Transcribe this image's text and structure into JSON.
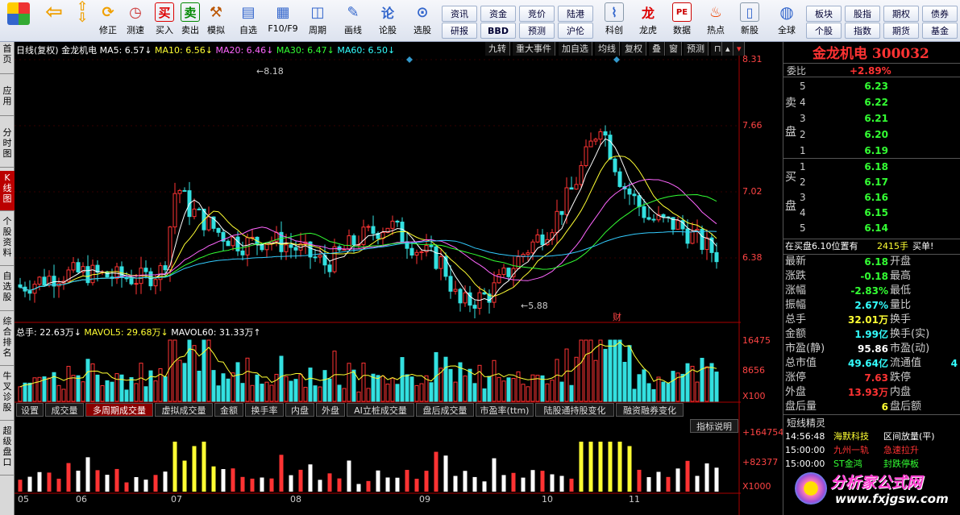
{
  "toolbar": {
    "buttons": [
      "修正",
      "测速",
      "买入",
      "卖出",
      "模拟",
      "自选",
      "F10/F9",
      "周期",
      "画线",
      "论股",
      "选股",
      "科创",
      "龙虎",
      "数据",
      "热点",
      "新股",
      "全球"
    ],
    "small_buttons": [
      "资讯",
      "研报",
      "资金",
      "BBD",
      "竞价",
      "预测",
      "陆港",
      "沪伦",
      "板块",
      "个股",
      "股指",
      "指数",
      "期权",
      "期货",
      "债券",
      "基金"
    ]
  },
  "sidebar": {
    "tabs": [
      "首页",
      "应用",
      "分时图",
      "K线图",
      "个股资料",
      "自选股",
      "综合排名",
      "牛叉诊股",
      "超级盘口"
    ]
  },
  "chart": {
    "header": {
      "period": "日线(复权)",
      "name": "金龙机电",
      "ma5": "MA5: 6.57↓",
      "ma10": "MA10: 6.56↓",
      "ma20": "MA20: 6.46↓",
      "ma30": "MA30: 6.47↓",
      "ma60": "MA60: 6.50↓"
    },
    "top_tabs": [
      "九转",
      "重大事件",
      "加自选",
      "均线",
      "复权",
      "叠",
      "窗",
      "预测"
    ],
    "price_axis": [
      "8.31",
      "7.66",
      "7.02",
      "6.38"
    ],
    "high_label": "8.18",
    "low_label": "5.88",
    "fin_marker": "财",
    "volume_header": {
      "total": "总手: 22.63万↓",
      "mavol5": "MAVOL5: 29.68万↓",
      "mavol60": "MAVOL60: 31.33万↑"
    },
    "volume_axis": [
      "16475",
      "8656",
      "X100"
    ],
    "bottom_tabs": [
      "设置",
      "成交量",
      "多周期成交量",
      "虚拟成交量",
      "金额",
      "换手率",
      "内盘",
      "外盘",
      "AI立桩成交量",
      "盘后成交量",
      "市盈率(ttm)",
      "陆股通持股变化",
      "融资融券变化"
    ],
    "indicator_note": "指标说明",
    "indicator_axis": [
      "+164754",
      "+82377",
      "X1000"
    ],
    "months": [
      "05",
      "06",
      "07",
      "08",
      "09",
      "10",
      "11"
    ]
  },
  "quote": {
    "title": "金龙机电 300032",
    "weibi_label": "委比",
    "weibi_value": "+2.89%",
    "sell_label": "卖盘",
    "buy_label": "买盘",
    "asks": [
      {
        "n": "5",
        "p": "6.23"
      },
      {
        "n": "4",
        "p": "6.22"
      },
      {
        "n": "3",
        "p": "6.21"
      },
      {
        "n": "2",
        "p": "6.20"
      },
      {
        "n": "1",
        "p": "6.19"
      }
    ],
    "bids": [
      {
        "n": "1",
        "p": "6.18"
      },
      {
        "n": "2",
        "p": "6.17"
      },
      {
        "n": "3",
        "p": "6.16"
      },
      {
        "n": "4",
        "p": "6.15"
      },
      {
        "n": "5",
        "p": "6.14"
      }
    ],
    "buyline": {
      "text": "在买盘6.10位置有",
      "vol": "2415手",
      "tag": "买单!"
    },
    "stats": [
      {
        "l1": "最新",
        "v1": "6.18",
        "c1": "green",
        "l2": "开盘",
        "v2": "",
        "c2": "wht"
      },
      {
        "l1": "涨跌",
        "v1": "-0.18",
        "c1": "green",
        "l2": "最高",
        "v2": "",
        "c2": "wht"
      },
      {
        "l1": "涨幅",
        "v1": "-2.83%",
        "c1": "green",
        "l2": "最低",
        "v2": "",
        "c2": "wht"
      },
      {
        "l1": "振幅",
        "v1": "2.67%",
        "c1": "cyan",
        "l2": "量比",
        "v2": "",
        "c2": "wht"
      },
      {
        "l1": "总手",
        "v1": "32.01万",
        "c1": "yel",
        "l2": "换手",
        "v2": "",
        "c2": "wht"
      },
      {
        "l1": "金额",
        "v1": "1.99亿",
        "c1": "cyan",
        "l2": "换手(实)",
        "v2": "",
        "c2": "wht"
      },
      {
        "l1": "市盈(静)",
        "v1": "95.86",
        "c1": "wht",
        "l2": "市盈(动)",
        "v2": "",
        "c2": "wht"
      },
      {
        "l1": "总市值",
        "v1": "49.64亿",
        "c1": "cyan",
        "l2": "流通值",
        "v2": "4",
        "c2": "cyan"
      },
      {
        "l1": "涨停",
        "v1": "7.63",
        "c1": "red",
        "l2": "跌停",
        "v2": "",
        "c2": "wht"
      },
      {
        "l1": "外盘",
        "v1": "13.93万",
        "c1": "red",
        "l2": "内盘",
        "v2": "",
        "c2": "wht"
      },
      {
        "l1": "盘后量",
        "v1": "6",
        "c1": "yel",
        "l2": "盘后额",
        "v2": "",
        "c2": "wht"
      }
    ],
    "sprite_title": "短线精灵",
    "sprites": [
      {
        "time": "14:56:48",
        "name": "海默科技",
        "event": "区间放量(平)",
        "ec": "wht",
        "nc": "yel"
      },
      {
        "time": "15:00:00",
        "name": "九州一轨",
        "event": "急速拉升",
        "ec": "red",
        "nc": "red"
      },
      {
        "time": "15:00:00",
        "name": "ST金鸿",
        "event": "封跌停板",
        "ec": "green",
        "nc": "green"
      }
    ],
    "watermark": "分析家公式网",
    "watermark_url": "www.fxjgsw.com"
  }
}
